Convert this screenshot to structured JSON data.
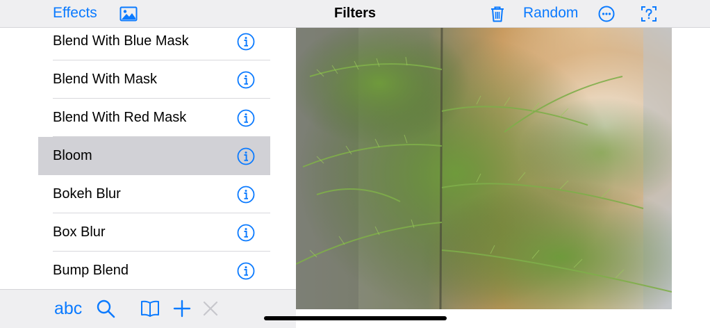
{
  "navbar": {
    "effects_label": "Effects",
    "title": "Filters",
    "random_label": "Random",
    "icons": [
      "photo-icon",
      "trash-icon",
      "more-icon",
      "help-icon"
    ]
  },
  "list": {
    "items": [
      {
        "label": "Blend With Blue Mask",
        "selected": false
      },
      {
        "label": "Blend With Mask",
        "selected": false
      },
      {
        "label": "Blend With Red Mask",
        "selected": false
      },
      {
        "label": "Bloom",
        "selected": true
      },
      {
        "label": "Bokeh Blur",
        "selected": false
      },
      {
        "label": "Box Blur",
        "selected": false
      },
      {
        "label": "Bump Blend",
        "selected": false
      }
    ]
  },
  "toolbar": {
    "abc_label": "abc",
    "icons": [
      "search-icon",
      "book-icon",
      "add-icon",
      "close-icon"
    ]
  },
  "colors": {
    "accent": "#0a7aff",
    "bar_background": "#efeff1",
    "selected_row": "#d1d1d6",
    "disabled": "#c7c7cc"
  }
}
